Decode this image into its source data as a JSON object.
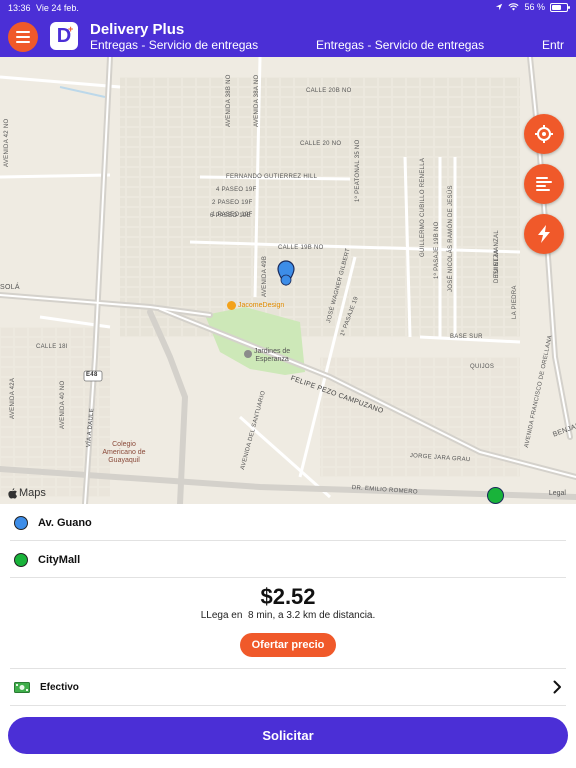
{
  "status_bar": {
    "time": "13:36",
    "date": "Vie 24 feb.",
    "battery": "56 %",
    "battery_level": 0.56
  },
  "header": {
    "app_title": "Delivery Plus",
    "subtitle_ticker": [
      "Entregas - Servicio de entregas",
      "Entregas - Servicio de entregas",
      "Entr"
    ],
    "logo_letter": "D",
    "accent_color": "#4b2fd6",
    "orange_color": "#f0592a"
  },
  "map": {
    "street_labels": {
      "calle_20b": "CALLE 20B NO",
      "calle_20": "CALLE 20 NO",
      "avenida_38a": "AVENIDA 38A NO",
      "avenida_38b": "AVENIDA 38B NO",
      "fernando": "FERNANDO GUTIERREZ HILL",
      "pasaje_19f_4": "4 PASEO 19F",
      "pasaje_19f_2": "2 PASEO 19F",
      "pasaje_19f_1": "1 PASEO 19F",
      "pasaje_19e_6": "6 PASEO 19E",
      "peatonal": "1º PEATONAL 35 NO",
      "guillermo": "GUILLERMO CUBILLO RENELLA",
      "jose_nicolas": "JOSÉ NICOLÁS RAMÓN DE JESÚS",
      "pasaje_19b": "1º PASAJE 19B NO",
      "calle_19b": "CALLE 19B NO",
      "avenida_49b": "AVENIDA 49B",
      "jose_wagner": "JOSÉ WAGNER GILBERT",
      "pasaje_19": "1º PASAJE 19",
      "tuintza": "TUINTZA",
      "desi_el_manzal": "DESI EL MANZAL",
      "la_piedra": "LA PIEDRA",
      "base_sur": "BASE SUR",
      "sola": "SOLÁ",
      "avenida_42_no": "AVENIDA 42 NO",
      "calle_18i": "CALLE 18I",
      "avenida_42a": "AVENIDA 42A",
      "avenida_40_no": "AVENIDA 40 NO",
      "e48": "E48",
      "via_a_daule": "VÍA A DAULE",
      "felipe": "FELIPE PEZO CAMPUZANO",
      "avenida_del_santuario": "AVENIDA DEL SANTUARIO",
      "quijos": "QUIJOS",
      "avenida_francisco": "AVENIDA FRANCISCO DE ORELLANA",
      "benjam": "BENJAM",
      "jorge_jara": "JORGE JARA GRAU",
      "dr_emilio": "DR. EMILIO ROMERO"
    },
    "pois": {
      "jacome": "JacomeDesign",
      "jardines_1": "Jardines de",
      "jardines_2": "Esperanza",
      "colegio_1": "Colegio",
      "colegio_2": "Americano de",
      "colegio_3": "Guayaquil"
    },
    "maps_logo": "Maps",
    "legal": "Legal",
    "fab_icons": [
      "crosshair-icon",
      "list-icon",
      "lightning-icon"
    ]
  },
  "route": {
    "origin": "Av. Guano",
    "origin_color": "#3d8de8",
    "destination": "CityMall",
    "destination_color": "#19b33a"
  },
  "quote": {
    "price": "$2.52",
    "eta": "LLega en  8 min, a 3.2 km de distancia.",
    "offer_label": "Ofertar precio"
  },
  "payment": {
    "method": "Efectivo",
    "icon": "cash-icon"
  },
  "submit_label": "Solicitar"
}
